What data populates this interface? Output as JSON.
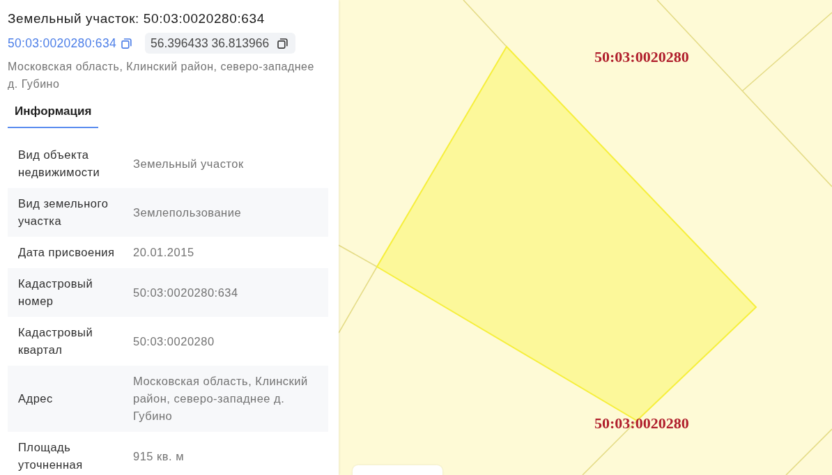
{
  "parcel": {
    "title": "Земельный участок: 50:03:0020280:634",
    "cadastral_number": "50:03:0020280:634",
    "coordinates": "56.396433 36.813966",
    "address": "Московская область, Клинский район, северо-западнее д. Губино"
  },
  "tabs": [
    {
      "label": "Информация",
      "selected": true
    }
  ],
  "info_table": {
    "rows": [
      {
        "label": "Вид объекта недвижимости",
        "value": "Земельный участок"
      },
      {
        "label": "Вид земельного участка",
        "value": "Землепользование"
      },
      {
        "label": "Дата присвоения",
        "value": "20.01.2015"
      },
      {
        "label": "Кадастровый номер",
        "value": "50:03:0020280:634"
      },
      {
        "label": "Кадастровый квартал",
        "value": "50:03:0020280"
      },
      {
        "label": "Адрес",
        "value": "Московская область, Клинский район, северо-западнее д. Губино"
      },
      {
        "label": "Площадь уточненная",
        "value": "915 кв. м"
      }
    ]
  },
  "map": {
    "labels": [
      "50:03:0020280",
      "50:03:0020280"
    ]
  }
}
